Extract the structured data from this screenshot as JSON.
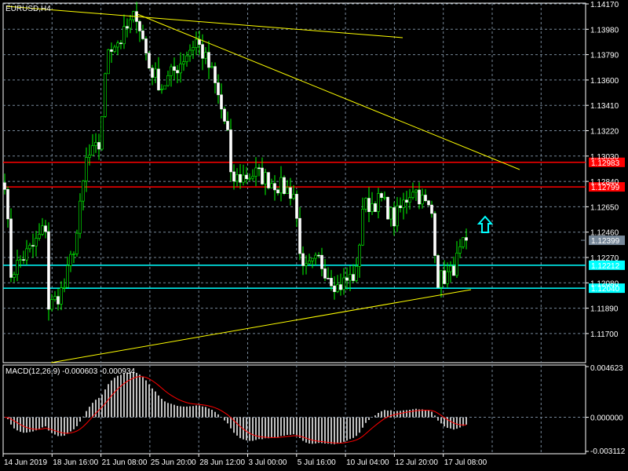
{
  "chart_title": "EURUSD,H4",
  "chart_data": {
    "type": "candlestick",
    "symbol": "EURUSD",
    "timeframe": "H4",
    "price_ticks": [
      "1.14170",
      "1.13980",
      "1.13790",
      "1.13600",
      "1.13410",
      "1.13220",
      "1.13030",
      "1.12840",
      "1.12650",
      "1.12460",
      "1.12270",
      "1.12080",
      "1.11890",
      "1.11700"
    ],
    "ylim": [
      1.115,
      1.142
    ],
    "date_labels": [
      "14 Jun 2019",
      "18 Jun 16:00",
      "21 Jun 08:00",
      "25 Jun 20:00",
      "28 Jun 12:00",
      "3 Jul 00:00",
      "5 Jul 16:00",
      "10 Jul 04:00",
      "12 Jul 20:00",
      "17 Jul 08:00"
    ],
    "close_keypoints": [
      [
        0,
        1.1285
      ],
      [
        2,
        1.1215
      ],
      [
        5,
        1.1225
      ],
      [
        9,
        1.1235
      ],
      [
        13,
        1.125
      ],
      [
        14,
        1.119
      ],
      [
        16,
        1.1195
      ],
      [
        19,
        1.1205
      ],
      [
        23,
        1.1245
      ],
      [
        26,
        1.13
      ],
      [
        30,
        1.131
      ],
      [
        33,
        1.1385
      ],
      [
        37,
        1.139
      ],
      [
        42,
        1.141
      ],
      [
        46,
        1.137
      ],
      [
        50,
        1.1355
      ],
      [
        55,
        1.137
      ],
      [
        61,
        1.139
      ],
      [
        66,
        1.1365
      ],
      [
        71,
        1.132
      ],
      [
        72,
        1.1285
      ],
      [
        80,
        1.129
      ],
      [
        92,
        1.1275
      ],
      [
        95,
        1.1215
      ],
      [
        100,
        1.1225
      ],
      [
        106,
        1.1205
      ],
      [
        112,
        1.1215
      ],
      [
        114,
        1.1265
      ],
      [
        120,
        1.127
      ],
      [
        124,
        1.1255
      ],
      [
        130,
        1.128
      ],
      [
        136,
        1.126
      ],
      [
        138,
        1.121
      ],
      [
        142,
        1.1215
      ],
      [
        147,
        1.124
      ]
    ],
    "horizontal_lines": [
      {
        "price": "1.12983",
        "color": "#ff0000"
      },
      {
        "price": "1.12799",
        "color": "#ff0000"
      },
      {
        "price": "1.12212",
        "color": "#00ffff"
      },
      {
        "price": "1.12040",
        "color": "#00ffff"
      }
    ],
    "current_price": "1.12399",
    "macd": {
      "label": "MACD(12,26,9) -0.000603 -0.000934",
      "ticks": [
        "0.004623",
        "0.000000",
        "-0.003112"
      ],
      "ylim": [
        -0.003112,
        0.004623
      ]
    }
  },
  "colors": {
    "grid": "#778899",
    "candle": "#00ff00",
    "trend": "#ffff00",
    "signal": "#ff0000",
    "hist": "#c0c0c0",
    "arrow": "#00ffff"
  }
}
